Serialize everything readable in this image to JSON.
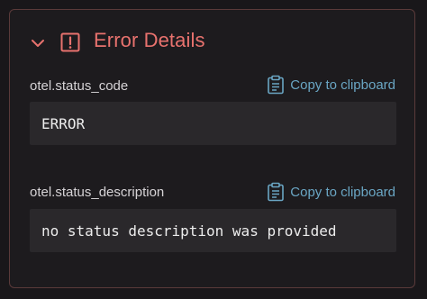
{
  "section": {
    "title": "Error Details",
    "icons": {
      "toggle": "chevron-down-icon",
      "status": "alert-square-icon",
      "copy": "clipboard-icon"
    },
    "colors": {
      "title": "#e8726e",
      "link": "#6aa6c4",
      "border": "#5a3a3a"
    }
  },
  "attributes": [
    {
      "key": "otel.status_code",
      "copy_label": "Copy to clipboard",
      "value": "ERROR"
    },
    {
      "key": "otel.status_description",
      "copy_label": "Copy to clipboard",
      "value": "no status description was provided"
    }
  ]
}
